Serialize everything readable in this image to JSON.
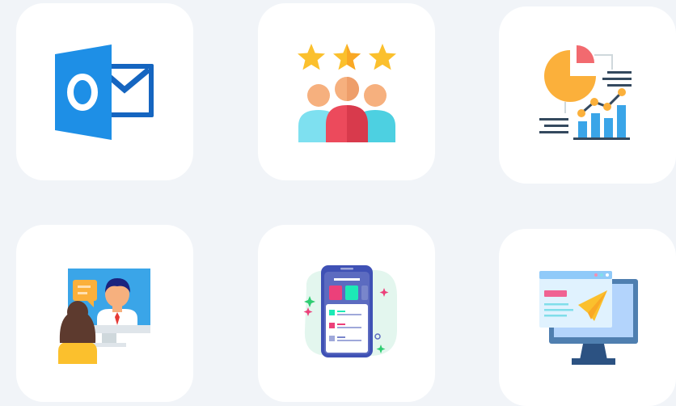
{
  "tiles": [
    {
      "icon": "outlook-mail-icon"
    },
    {
      "icon": "customer-rating-icon"
    },
    {
      "icon": "data-analytics-icon"
    },
    {
      "icon": "video-call-icon"
    },
    {
      "icon": "mobile-app-icon"
    },
    {
      "icon": "email-campaign-icon"
    }
  ],
  "colors": {
    "page_background": "#f1f4f8",
    "tile_background": "#ffffff",
    "outlook_blue": "#1e8fe6",
    "star_yellow": "#fbc02d",
    "accent_red": "#ec4a5c",
    "accent_cyan": "#4dd0e1",
    "chart_blue": "#3aa5e8"
  }
}
